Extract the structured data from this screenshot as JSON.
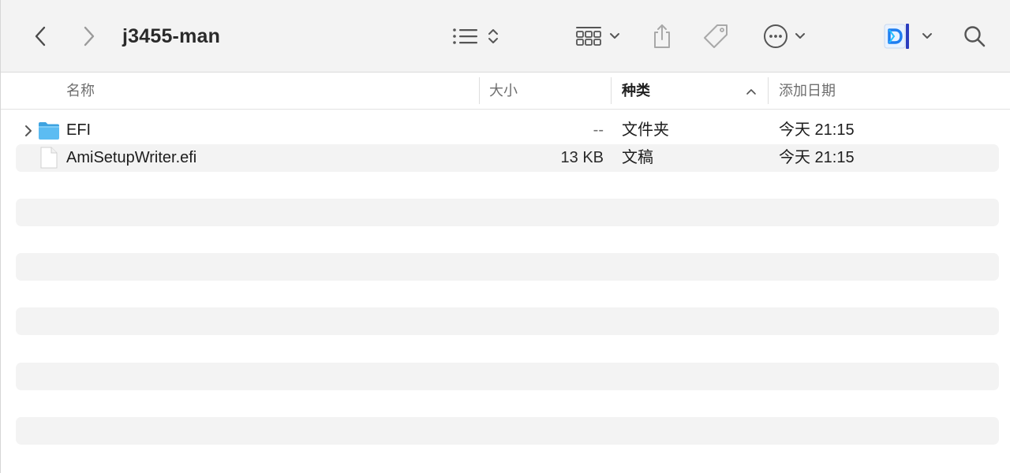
{
  "window": {
    "title": "j3455-man"
  },
  "toolbar": {
    "icons": [
      "back-chevron-icon",
      "forward-chevron-icon",
      "list-view-icon",
      "sort-updown-icon",
      "group-grid-icon",
      "chevron-down-icon",
      "share-icon",
      "tag-icon",
      "more-ellipsis-icon",
      "chevron-down-icon",
      "app-extension-icon",
      "chevron-down-icon",
      "search-icon"
    ]
  },
  "columns": {
    "name": "名称",
    "size": "大小",
    "kind": "种类",
    "date": "添加日期",
    "sorted_by": "kind",
    "sort_direction": "ascending"
  },
  "files": [
    {
      "name": "EFI",
      "size": "--",
      "kind": "文件夹",
      "date": "今天 21:15",
      "type": "folder",
      "expandable": true
    },
    {
      "name": "AmiSetupWriter.efi",
      "size": "13 KB",
      "kind": "文稿",
      "date": "今天 21:15",
      "type": "document",
      "expandable": false
    }
  ],
  "colors": {
    "toolbar_bg": "#f3f3f3",
    "stripe": "#f3f3f3",
    "folder_blue": "#4fb4ec",
    "app_icon_blue": "#1e7df0"
  }
}
